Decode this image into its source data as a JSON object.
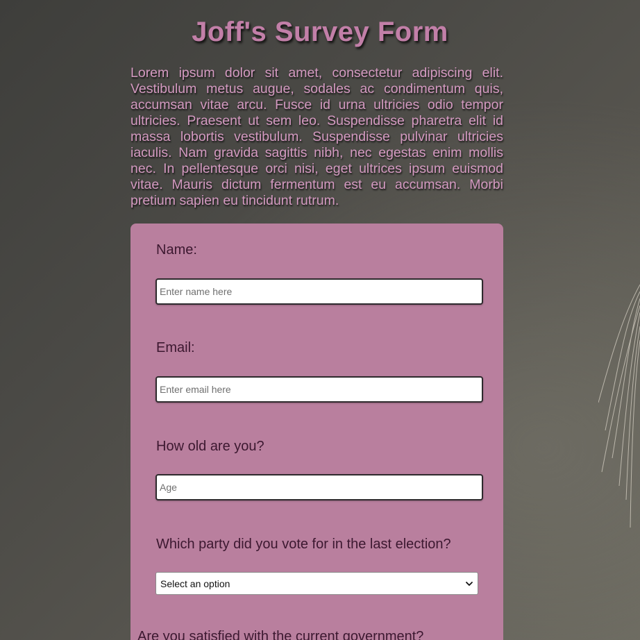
{
  "header": {
    "title": "Joff's Survey Form"
  },
  "intro": {
    "text": "Lorem ipsum dolor sit amet, consectetur adipiscing elit. Vestibulum metus augue, sodales ac condimentum quis, accumsan vitae arcu. Fusce id urna ultricies odio tempor ultricies. Praesent ut sem leo. Suspendisse pharetra elit id massa lobortis vestibulum. Suspendisse pulvinar ultricies iaculis. Nam gravida sagittis nibh, nec egestas enim mollis nec. In pellentesque orci nisi, eget ultrices ipsum euismod vitae. Mauris dictum fermentum est eu accumsan. Morbi pretium sapien eu tincidunt rutrum."
  },
  "form": {
    "name": {
      "label": "Name:",
      "placeholder": "Enter name here",
      "value": ""
    },
    "email": {
      "label": "Email:",
      "placeholder": "Enter email here",
      "value": ""
    },
    "age": {
      "label": "How old are you?",
      "placeholder": "Age",
      "value": ""
    },
    "party": {
      "label": "Which party did you vote for in the last election?",
      "selected": "Select an option"
    },
    "satisfaction": {
      "label": "Are you satisfied with the current government?"
    }
  },
  "colors": {
    "title": "#c27fa8",
    "card": "#b97f9e",
    "label": "#3c1830"
  },
  "icons": {
    "select_arrow": "chevron-down-icon"
  }
}
